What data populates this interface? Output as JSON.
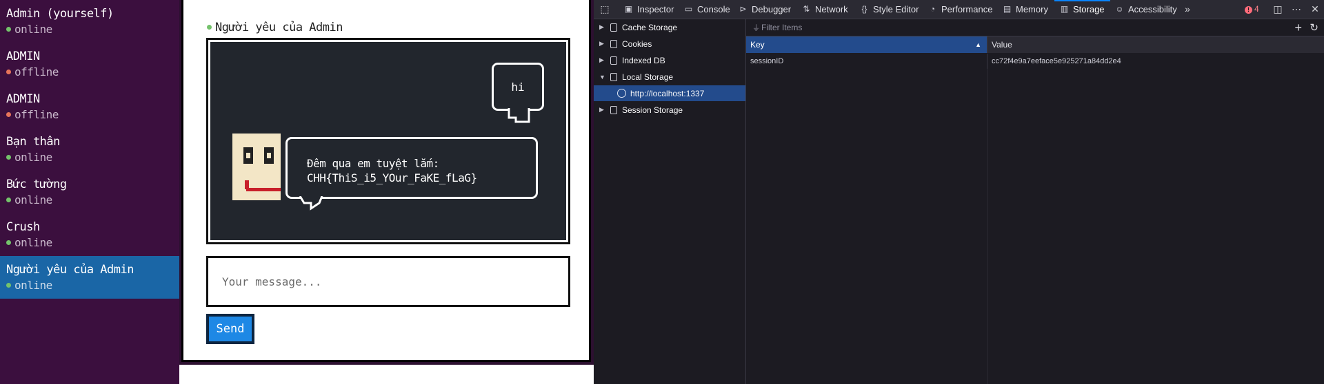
{
  "sidebar": {
    "contacts": [
      {
        "name": "Admin (yourself)",
        "status": "online",
        "status_color": "#74c26b"
      },
      {
        "name": "ADMIN",
        "status": "offline",
        "status_color": "#e6745a"
      },
      {
        "name": "ADMIN",
        "status": "offline",
        "status_color": "#e6745a"
      },
      {
        "name": "Bạn thân",
        "status": "online",
        "status_color": "#74c26b"
      },
      {
        "name": "Bức tường",
        "status": "online",
        "status_color": "#74c26b"
      },
      {
        "name": "Crush",
        "status": "online",
        "status_color": "#74c26b"
      },
      {
        "name": "Người yêu của Admin",
        "status": "online",
        "status_color": "#74c26b",
        "active": true
      }
    ]
  },
  "chat": {
    "title": "Người yêu của Admin",
    "messages": {
      "outgoing": "hi",
      "incoming_line1": "Đêm qua em tuyệt lắm:",
      "incoming_line2": "CHH{ThiS_i5_YOur_FaKE_fLaG}"
    },
    "input_placeholder": "Your message...",
    "send_label": "Send"
  },
  "devtools": {
    "tabs": [
      {
        "label": "Inspector",
        "icon": "inspector-icon"
      },
      {
        "label": "Console",
        "icon": "console-icon"
      },
      {
        "label": "Debugger",
        "icon": "debugger-icon"
      },
      {
        "label": "Network",
        "icon": "network-icon"
      },
      {
        "label": "Style Editor",
        "icon": "style-editor-icon"
      },
      {
        "label": "Performance",
        "icon": "performance-icon"
      },
      {
        "label": "Memory",
        "icon": "memory-icon"
      },
      {
        "label": "Storage",
        "icon": "storage-icon",
        "active": true
      },
      {
        "label": "Accessibility",
        "icon": "accessibility-icon"
      }
    ],
    "error_count": "4",
    "tree": [
      {
        "label": "Cache Storage",
        "expanded": false
      },
      {
        "label": "Cookies",
        "expanded": false
      },
      {
        "label": "Indexed DB",
        "expanded": false
      },
      {
        "label": "Local Storage",
        "expanded": true
      },
      {
        "label": "http://localhost:1337",
        "selected": true
      },
      {
        "label": "Session Storage",
        "expanded": false
      }
    ],
    "filter_placeholder": "Filter Items",
    "table": {
      "headers": {
        "key": "Key",
        "value": "Value"
      },
      "rows": [
        {
          "key": "sessionID",
          "value": "cc72f4e9a7eeface5e925271a84dd2e4"
        }
      ]
    },
    "accent_color": "#0a84ff"
  }
}
